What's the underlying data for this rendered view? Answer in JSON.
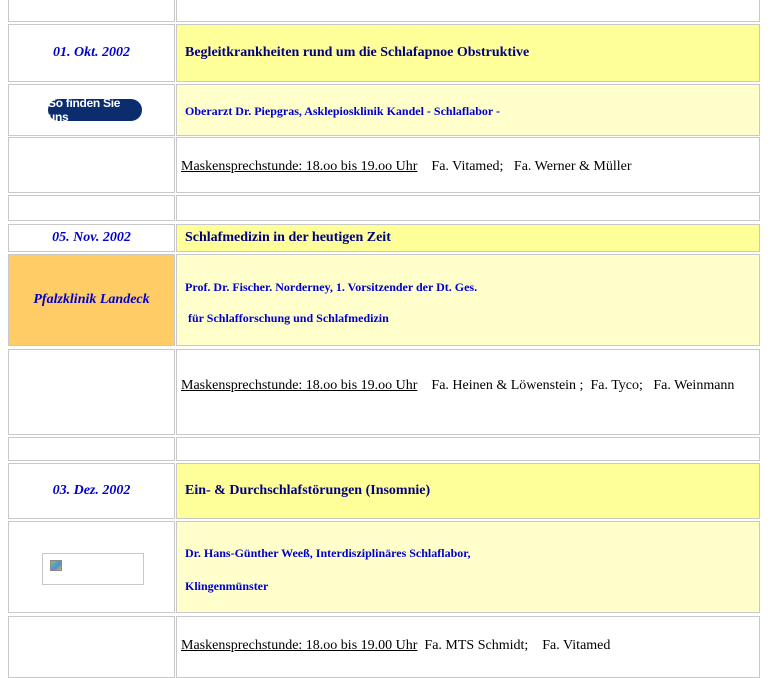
{
  "events": [
    {
      "date": "01. Okt. 2002",
      "title": "Begleitkrankheiten  rund um die Schlafapnoe Obstruktive",
      "link_button": "So finden Sie uns",
      "speaker_lines": [
        "Oberarzt Dr. Piepgras, Asklepiosklinik Kandel - Schlaflabor -"
      ],
      "mask_label": "Maskensprechstunde:  18.oo bis 19.oo Uhr",
      "mask_firms": "    Fa. Vitamed;   Fa. Werner & Müller"
    },
    {
      "date": "05. Nov. 2002",
      "title": "Schlafmedizin in der heutigen Zeit",
      "location": "Pfalzklinik Landeck",
      "speaker_lines": [
        "Prof. Dr. Fischer. Norderney, 1. Vorsitzender der Dt. Ges.",
        " für Schlafforschung und Schlafmedizin"
      ],
      "mask_label": "Maskensprechstunde:  18.oo bis 19.oo Uhr",
      "mask_firms": "    Fa. Heinen & Löwenstein ;  Fa. Tyco;   Fa. Weinmann"
    },
    {
      "date": "03. Dez. 2002",
      "title": "Ein- & Durchschlafstörungen (Insomnie)",
      "speaker_lines": [
        "Dr. Hans-Günther Weeß, Interdisziplinäres Schlaflabor,",
        "Klingenmünster"
      ],
      "mask_label": "Maskensprechstunde: 18.oo bis 19.00 Uhr",
      "mask_firms": "  Fa. MTS Schmidt;    Fa. Vitamed"
    }
  ],
  "icons": {
    "broken_image": "broken-image-icon"
  }
}
